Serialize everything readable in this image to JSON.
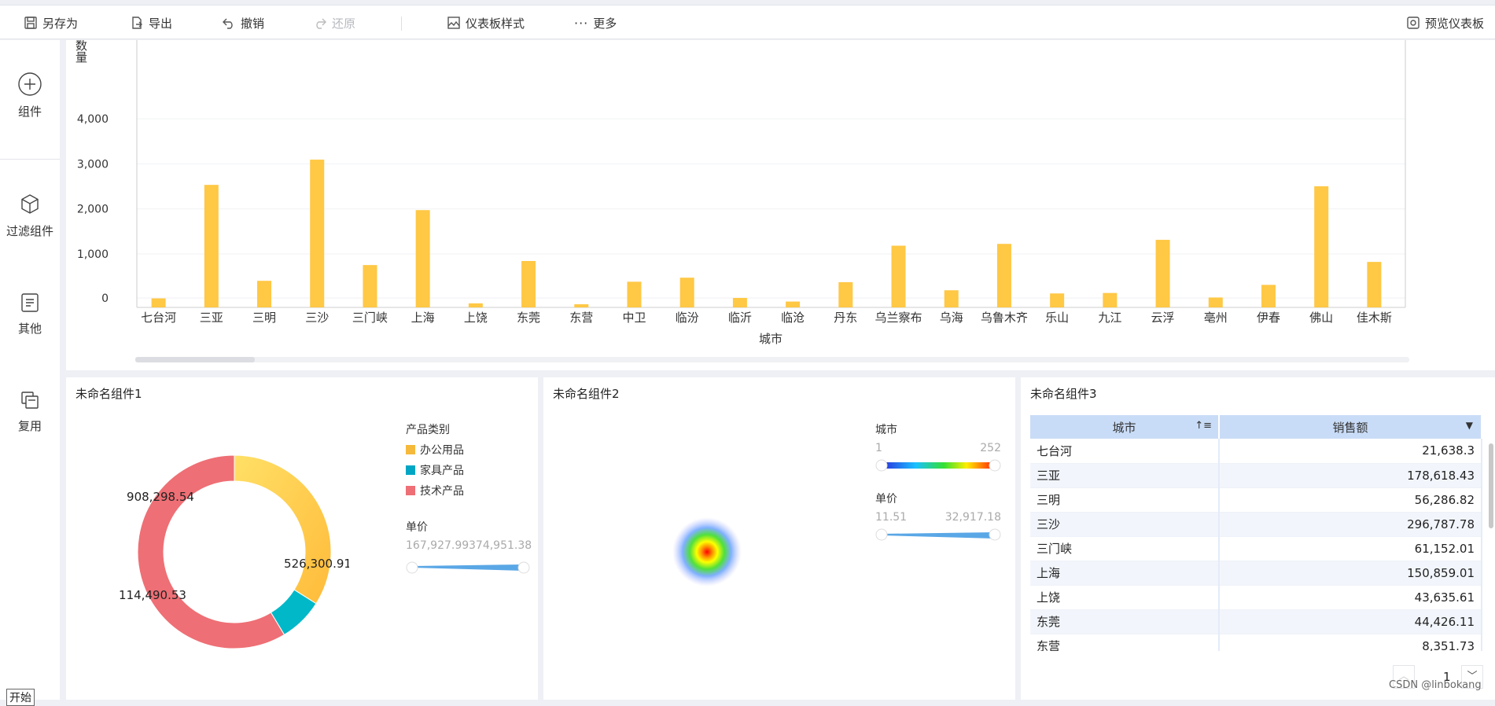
{
  "toolbar": {
    "save_as": "另存为",
    "export": "导出",
    "undo": "撤销",
    "redo": "还原",
    "dashboard_style": "仪表板样式",
    "more": "更多",
    "preview": "预览仪表板"
  },
  "sidebar": {
    "components": "组件",
    "filter_components": "过滤组件",
    "others": "其他",
    "reuse": "复用",
    "start": "开始"
  },
  "bar_chart": {
    "ylabel": "数\n量",
    "xlabel": "城市"
  },
  "chart_data": [
    {
      "type": "bar",
      "xlabel": "城市",
      "ylabel": "数量",
      "ylim": [
        0,
        4800
      ],
      "yticks": [
        "0",
        "1,000",
        "2,000",
        "3,000",
        "4,000"
      ],
      "ytick_values": [
        0,
        1000,
        2000,
        3000,
        4000
      ],
      "categories": [
        "七台河",
        "三亚",
        "三明",
        "三沙",
        "三门峡",
        "上海",
        "上饶",
        "东莞",
        "东营",
        "中卫",
        "临汾",
        "临沂",
        "临沧",
        "丹东",
        "乌兰察布",
        "乌海",
        "乌鲁木齐",
        "乐山",
        "九江",
        "云浮",
        "亳州",
        "伊春",
        "佛山",
        "佳木斯"
      ],
      "values": [
        200,
        2720,
        590,
        3280,
        940,
        2160,
        90,
        1030,
        70,
        570,
        660,
        210,
        130,
        560,
        1370,
        380,
        1410,
        310,
        320,
        1500,
        220,
        500,
        2690,
        1010
      ],
      "grid": true,
      "color": "#ffc845"
    },
    {
      "type": "pie",
      "title": "未命名组件1",
      "legend_title": "产品类别",
      "labels": [
        "办公用品",
        "家具产品",
        "技术产品"
      ],
      "values": [
        526300.91,
        114490.53,
        908298.54
      ],
      "value_labels": [
        "526,300.91",
        "114,490.53",
        "908,298.54"
      ],
      "colors": [
        "#ffc845",
        "#00b8c8",
        "#ee6f75"
      ],
      "legend_placement": "right"
    }
  ],
  "pie_panel": {
    "title": "未命名组件1",
    "legend_title": "产品类别",
    "legend": [
      "办公用品",
      "家具产品",
      "技术产品"
    ],
    "legend_colors": [
      "#f5b93b",
      "#00a6c4",
      "#ee6f75"
    ],
    "unit_title": "单价",
    "unit_min": "167,927.99",
    "unit_max": "374,951.38",
    "slice_labels": [
      "526,300.91",
      "114,490.53",
      "908,298.54"
    ]
  },
  "heat_panel": {
    "title": "未命名组件2",
    "city_title": "城市",
    "city_min": "1",
    "city_max": "252",
    "unit_title": "单价",
    "unit_min": "11.51",
    "unit_max": "32,917.18"
  },
  "table_panel": {
    "title": "未命名组件3",
    "columns": [
      "城市",
      "销售额"
    ],
    "rows": [
      [
        "七台河",
        "21,638.3"
      ],
      [
        "三亚",
        "178,618.43"
      ],
      [
        "三明",
        "56,286.82"
      ],
      [
        "三沙",
        "296,787.78"
      ],
      [
        "三门峡",
        "61,152.01"
      ],
      [
        "上海",
        "150,859.01"
      ],
      [
        "上饶",
        "43,635.61"
      ],
      [
        "东莞",
        "44,426.11"
      ],
      [
        "东营",
        "8,351.73"
      ]
    ],
    "page": "1"
  },
  "watermark": "CSDN @linbokang"
}
